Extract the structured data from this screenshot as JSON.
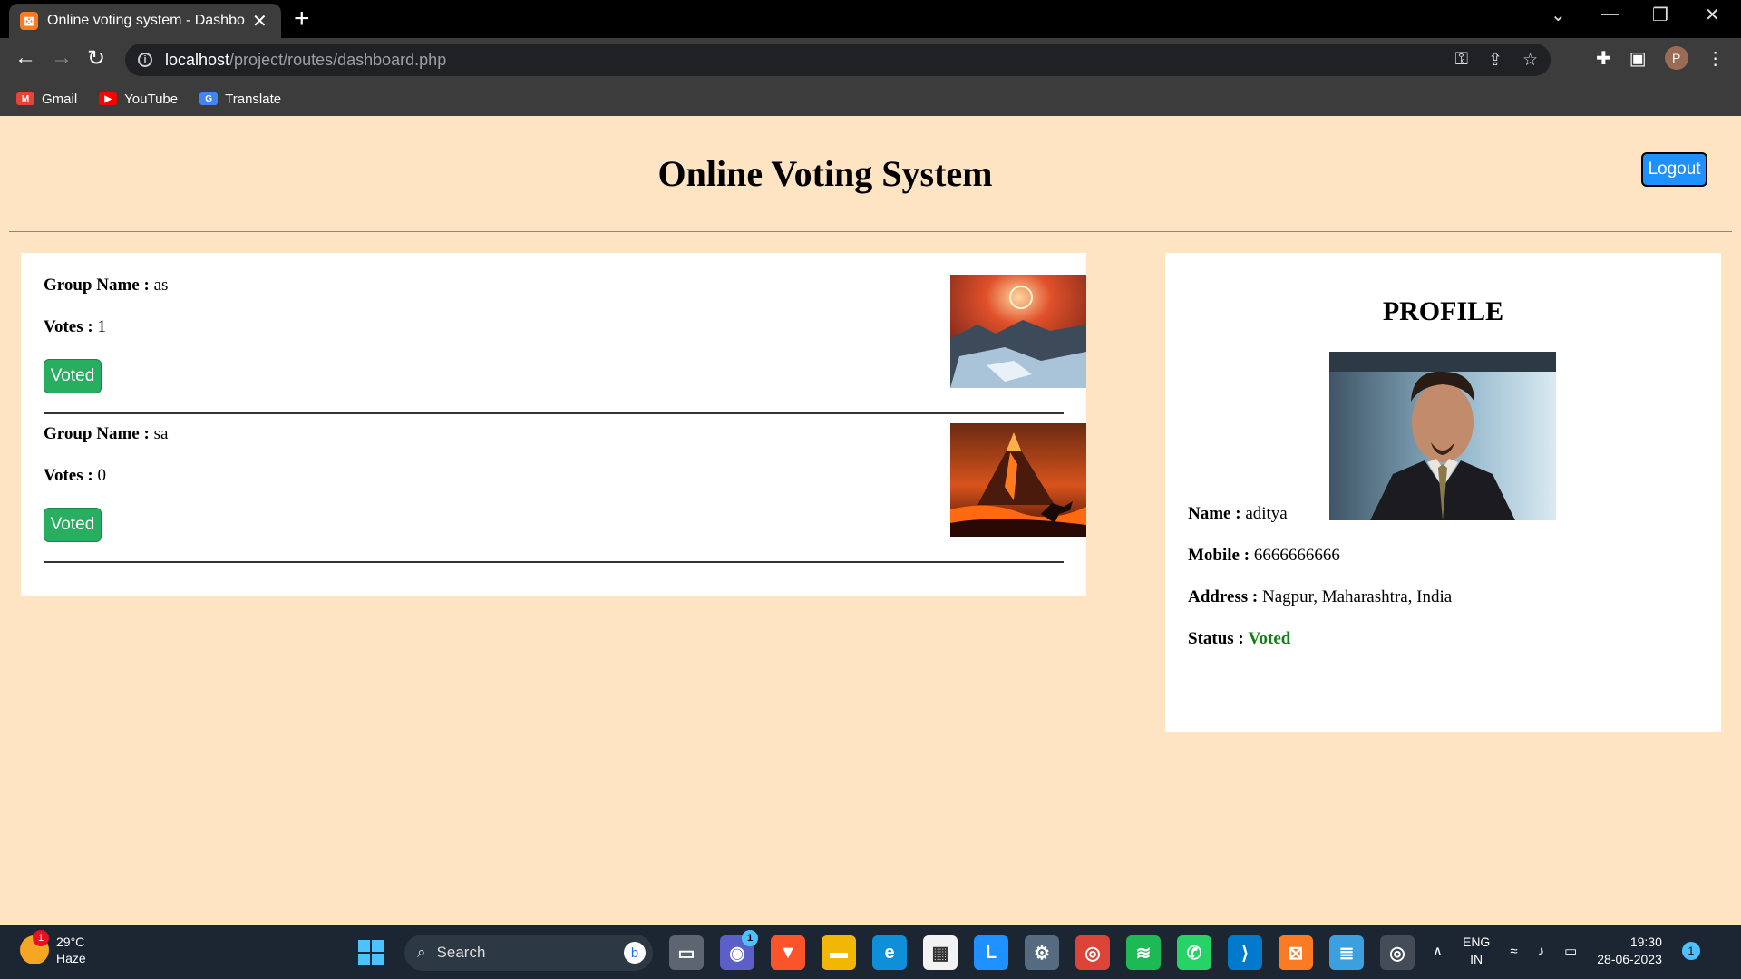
{
  "browser": {
    "tab_title": "Online voting system - Dashboard",
    "tab_close": "✕",
    "new_tab": "+",
    "url_host": "localhost",
    "url_path": "/project/routes/dashboard.php",
    "bookmarks": [
      {
        "label": "Gmail",
        "icon": "gmail-icon",
        "color": "#EA4335"
      },
      {
        "label": "YouTube",
        "icon": "youtube-icon",
        "color": "#FF0000"
      },
      {
        "label": "Translate",
        "icon": "translate-icon",
        "color": "#4285F4"
      }
    ],
    "profile_initial": "P"
  },
  "page": {
    "title": "Online Voting System",
    "logout_label": "Logout"
  },
  "groups": [
    {
      "name_label": "Group Name :",
      "name": "as",
      "votes_label": "Votes :",
      "votes": "1",
      "button_label": "Voted"
    },
    {
      "name_label": "Group Name :",
      "name": "sa",
      "votes_label": "Votes :",
      "votes": "0",
      "button_label": "Voted"
    }
  ],
  "profile": {
    "title": "PROFILE",
    "name_label": "Name :",
    "name": "aditya",
    "mobile_label": "Mobile :",
    "mobile": "6666666666",
    "address_label": "Address :",
    "address": "Nagpur, Maharashtra, India",
    "status_label": "Status :",
    "status": "Voted",
    "status_color": "#118011"
  },
  "taskbar": {
    "weather_temp": "29°C",
    "weather_desc": "Haze",
    "weather_badge": "1",
    "search_label": "Search",
    "teams_badge": "1",
    "lang_line1": "ENG",
    "lang_line2": "IN",
    "time": "19:30",
    "date": "28-06-2023",
    "notification_count": "1"
  }
}
